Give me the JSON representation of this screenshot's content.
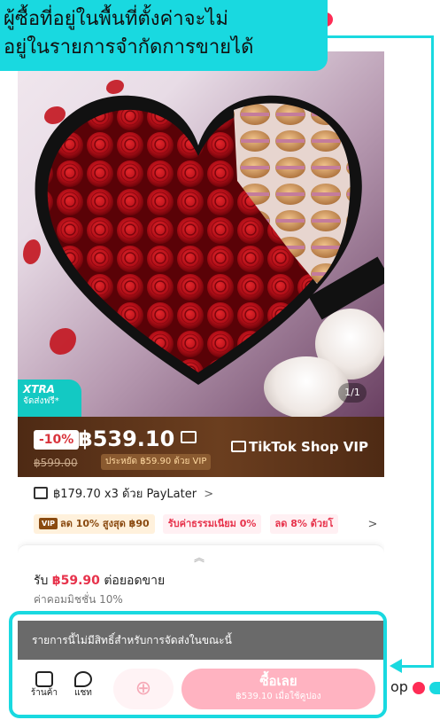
{
  "annotation": {
    "callout_lines": [
      "ผู้ซื้อที่อยู่ในพื้นที่ตั้งค่าจะไม่",
      "อยู่ในรายการจำกัดการขายได้"
    ],
    "edge_text": "op",
    "accent_color": "#19d9e0"
  },
  "gallery": {
    "image_counter": "1/1",
    "badge_title": "XTRA",
    "badge_subtitle": "จัดส่งฟรี*"
  },
  "price": {
    "discount": "-10%",
    "current": "฿539.10",
    "original": "฿599.00",
    "vip_saving": "ประหยัด ฿59.90 ด้วย VIP",
    "vip_brand": "TikTok Shop VIP"
  },
  "paylater": {
    "text": "฿179.70 x3 ด้วย PayLater",
    "chevron": ">"
  },
  "offers": [
    {
      "vip_mark": "VIP",
      "label": "ลด 10% สูงสุด ฿90"
    },
    {
      "label": "รับค่าธรรมเนียม 0%"
    },
    {
      "label": "ลด 8% ด้วยโ"
    }
  ],
  "offers_chevron": ">",
  "commission": {
    "expand_glyph": "︽",
    "earn_prefix": "รับ",
    "earn_amount": "฿59.90",
    "earn_suffix": "ต่อยอดขาย",
    "rate": "ค่าคอมมิชชั่น 10%"
  },
  "bottom": {
    "ineligible_notice": "รายการนี้ไม่มีสิทธิ์สำหรับการจัดส่งในขณะนี้",
    "store_label": "ร้านค้า",
    "chat_label": "แชท",
    "cart_glyph": "⊕",
    "buy_label": "ซื้อเลย",
    "buy_sub": "฿539.10 เมื่อใช้คูปอง"
  },
  "colors": {
    "brand_pink": "#fe2c55",
    "buy_button": "#ffb3c1",
    "price_banner": "#5a3218",
    "teal_badge": "#13c9c3"
  }
}
